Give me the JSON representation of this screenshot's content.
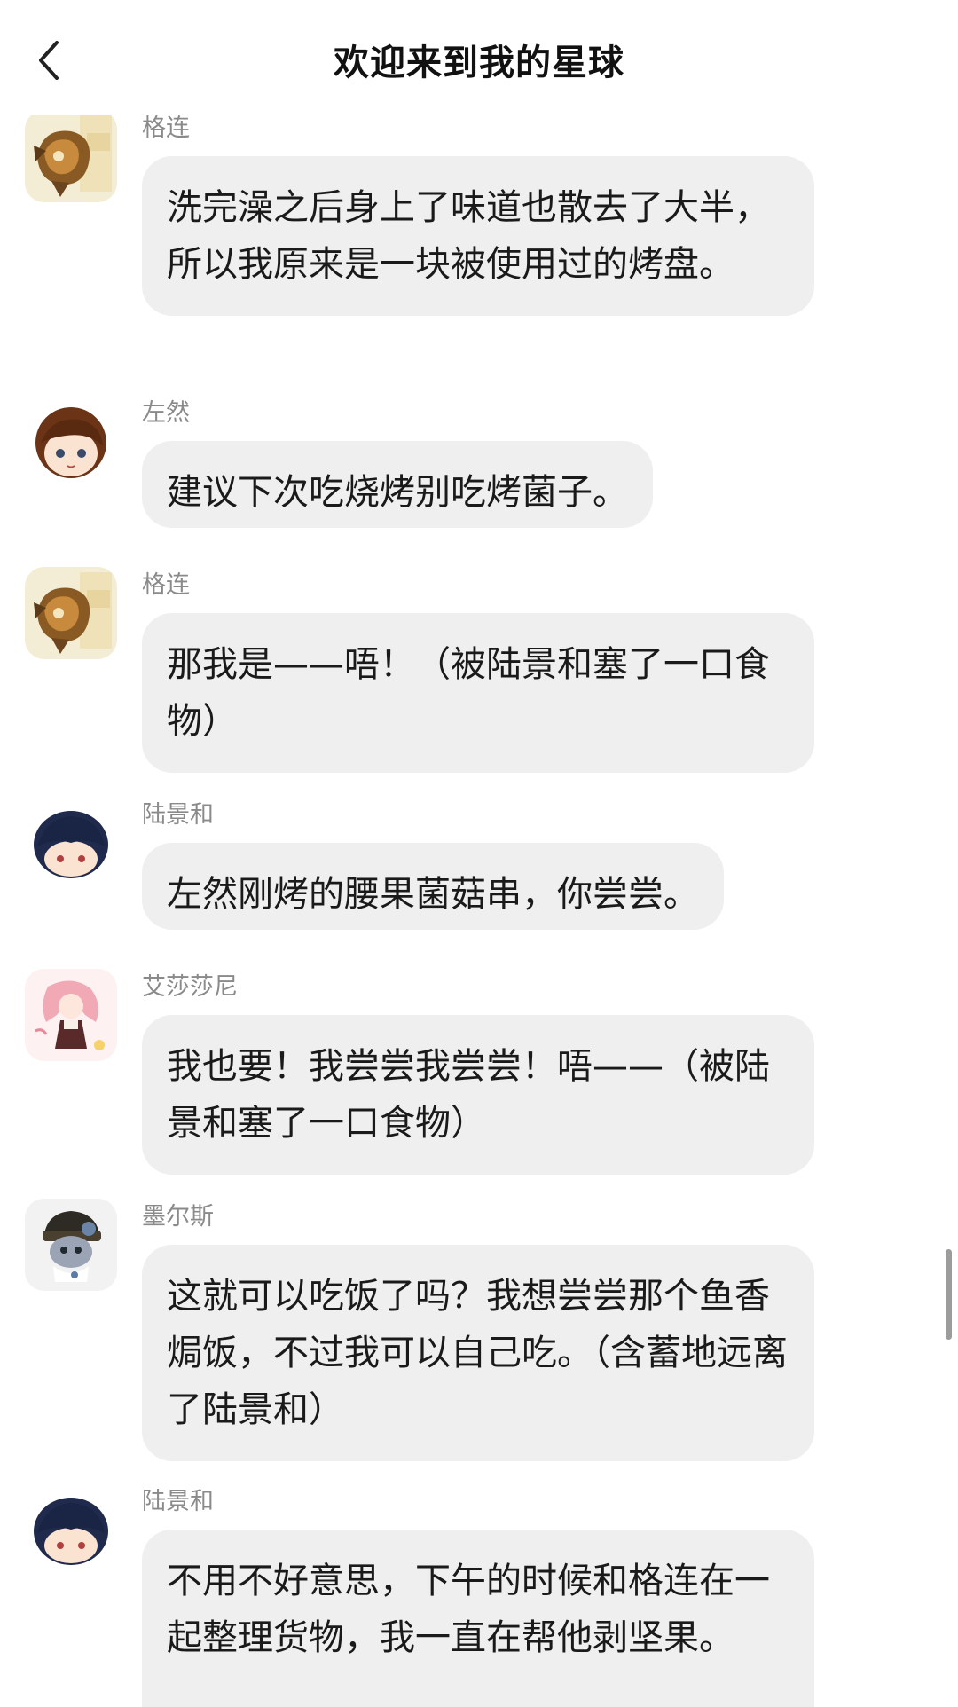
{
  "header": {
    "title": "欢迎来到我的星球",
    "back_icon": "chevron-left-icon"
  },
  "messages": [
    {
      "sender": "格连",
      "avatar": "avatar-glen",
      "text": "洗完澡之后身上了味道也散去了大半，所以我原来是一块被使用过的烤盘。"
    },
    {
      "sender": "左然",
      "avatar": "avatar-zuoran",
      "text": "建议下次吃烧烤别吃烤菌子。"
    },
    {
      "sender": "格连",
      "avatar": "avatar-glen",
      "text": "那我是——唔！（被陆景和塞了一口食物）"
    },
    {
      "sender": "陆景和",
      "avatar": "avatar-lujinghe",
      "text": "左然刚烤的腰果菌菇串，你尝尝。"
    },
    {
      "sender": "艾莎莎尼",
      "avatar": "avatar-aishashani",
      "text": "我也要！我尝尝我尝尝！唔——（被陆景和塞了一口食物）"
    },
    {
      "sender": "墨尔斯",
      "avatar": "avatar-moers",
      "text": "这就可以吃饭了吗？我想尝尝那个鱼香焗饭，不过我可以自己吃。（含蓄地远离了陆景和）"
    },
    {
      "sender": "陆景和",
      "avatar": "avatar-lujinghe",
      "text": "不用不好意思，下午的时候和格连在一起整理货物，我一直在帮他剥坚果。"
    }
  ],
  "colors": {
    "bubble": "#efefef",
    "name": "#8a8a8a",
    "text": "#1a1a1a",
    "scrollbar": "#9c9c9c"
  }
}
